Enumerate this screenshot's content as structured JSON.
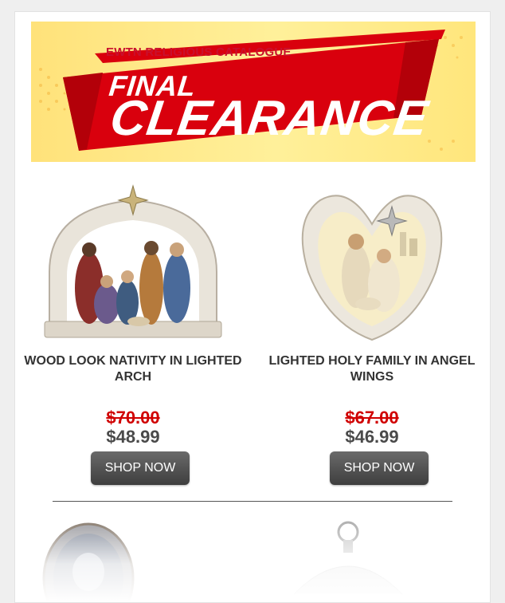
{
  "banner": {
    "catalogue": "EWTN RELIGIOUS CATALOGUE",
    "final": "FINAL",
    "clearance": "CLEARANCE"
  },
  "products": [
    {
      "name": "WOOD LOOK NATIVITY IN LIGHTED ARCH",
      "old_price": "$70.00",
      "new_price": "$48.99",
      "button": "SHOP NOW"
    },
    {
      "name": "LIGHTED HOLY FAMILY IN ANGEL WINGS",
      "old_price": "$67.00",
      "new_price": "$46.99",
      "button": "SHOP NOW"
    }
  ],
  "colors": {
    "banner_red": "#d9000d",
    "banner_yellow": "#ffe27a",
    "old_price": "#d00000",
    "button": "#4a4a4a"
  }
}
